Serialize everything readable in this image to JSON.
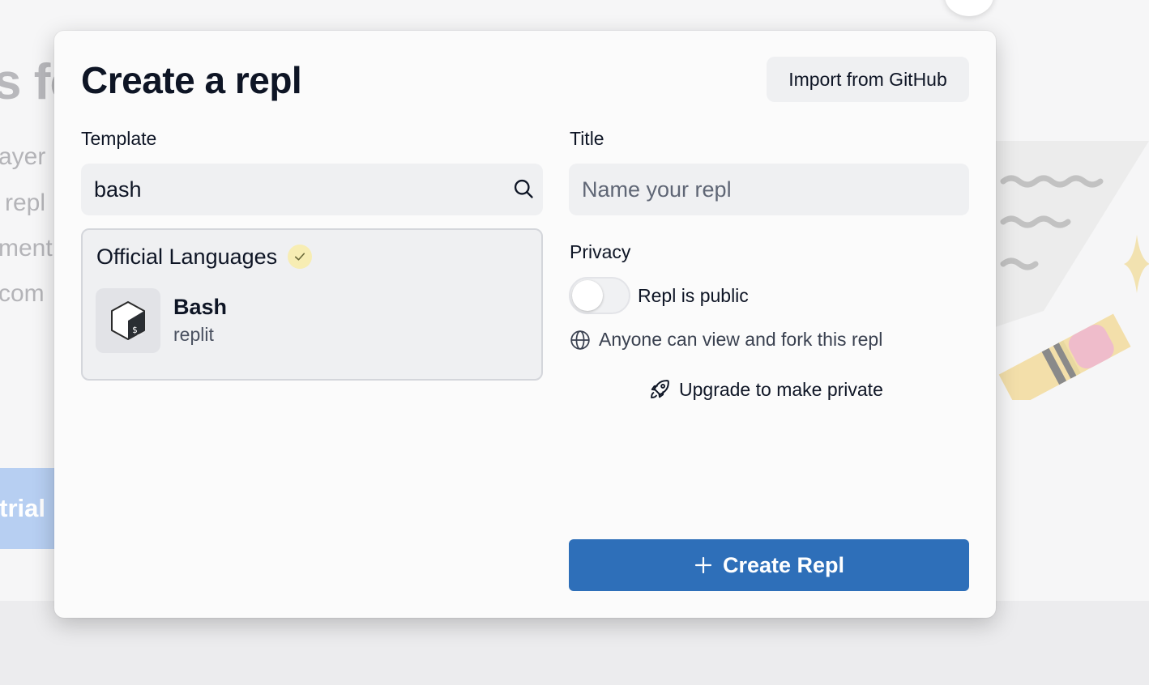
{
  "background": {
    "heading_fragment": "s fo",
    "lines": [
      "ayer",
      "repl",
      "ment",
      "com"
    ],
    "trial_button": "trial"
  },
  "modal": {
    "title": "Create a repl",
    "import_button": "Import from GitHub",
    "template": {
      "label": "Template",
      "search_value": "bash",
      "group_title": "Official Languages",
      "results": [
        {
          "name": "Bash",
          "owner": "replit",
          "icon": "bash-terminal-icon"
        }
      ]
    },
    "title_field": {
      "label": "Title",
      "placeholder": "Name your repl",
      "value": ""
    },
    "privacy": {
      "label": "Privacy",
      "toggle_label": "Repl is public",
      "toggle_on": false,
      "description": "Anyone can view and fork this repl",
      "upgrade_link": "Upgrade to make private"
    },
    "create_button": "Create Repl"
  },
  "colors": {
    "primary": "#2e6fb9",
    "verified_badge": "#f7edb3",
    "field_bg": "#eff0f2"
  }
}
